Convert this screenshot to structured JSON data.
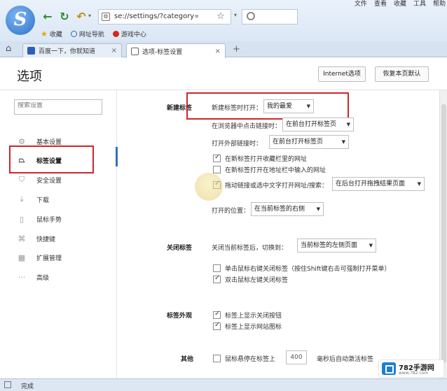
{
  "menu": {
    "file": "文件",
    "view": "查看",
    "favorites": "收藏",
    "tools": "工具",
    "help": "帮助"
  },
  "address": {
    "url": "se://settings/?category=tab"
  },
  "bookmarks": [
    {
      "label": "收藏"
    },
    {
      "label": "网址导航"
    },
    {
      "label": "游戏中心"
    }
  ],
  "tabs": [
    {
      "label": "百度一下，你就知道"
    },
    {
      "label": "选项-标签设置"
    }
  ],
  "header": {
    "title": "选项",
    "internet_options": "Internet选项",
    "restore_default": "恢复本页默认"
  },
  "sidebar": {
    "search_placeholder": "搜索设置",
    "items": [
      {
        "label": "基本设置",
        "icon": "gear-icon"
      },
      {
        "label": "标签设置",
        "icon": "tab-icon"
      },
      {
        "label": "安全设置",
        "icon": "shield-icon"
      },
      {
        "label": "下载",
        "icon": "download-icon"
      },
      {
        "label": "鼠标手势",
        "icon": "mouse-icon"
      },
      {
        "label": "快捷键",
        "icon": "keyboard-icon"
      },
      {
        "label": "扩展管理",
        "icon": "extension-icon"
      },
      {
        "label": "高级",
        "icon": "more-icon"
      }
    ]
  },
  "sections": {
    "new_tab": {
      "title": "新建标签",
      "open_label": "新建标签时打开：",
      "open_value": "我的最爱",
      "browser_click_label": "在浏览器中点击链接时：",
      "browser_click_value": "在前台打开标签页",
      "external_label": "打开外部链接时：",
      "external_value": "在前台打开标签页",
      "cb_favorites": "在新标签打开收藏栏里的网址",
      "cb_address": "在新标签打开在地址栏中输入的网址",
      "cb_drag": "拖动链接或选中文字打开网址/搜索：",
      "drag_value": "在后台打开拖拽结果页面",
      "position_label": "打开的位置：",
      "position_value": "在当前标签的右侧"
    },
    "close_tab": {
      "title": "关闭标签",
      "switch_label": "关闭当前标签后，切换到：",
      "switch_value": "当前标签的左侧页面",
      "cb_right_click": "单击鼠标右键关闭标签（按住Shift键右击可强制打开菜单）",
      "cb_double_click": "双击鼠标左键关闭标签"
    },
    "appearance": {
      "title": "标签外观",
      "cb_close_btn": "标签上显示关闭按钮",
      "cb_favicon": "标签上显示网站图标"
    },
    "other": {
      "title": "其他",
      "cb_hover_prefix": "鼠标悬停在标签上",
      "hover_ms": "400",
      "cb_hover_suffix": "毫秒后自动激活标签"
    }
  },
  "status": {
    "text": "完成"
  },
  "watermark": {
    "title": "782手游网",
    "url": "www.782.com"
  }
}
